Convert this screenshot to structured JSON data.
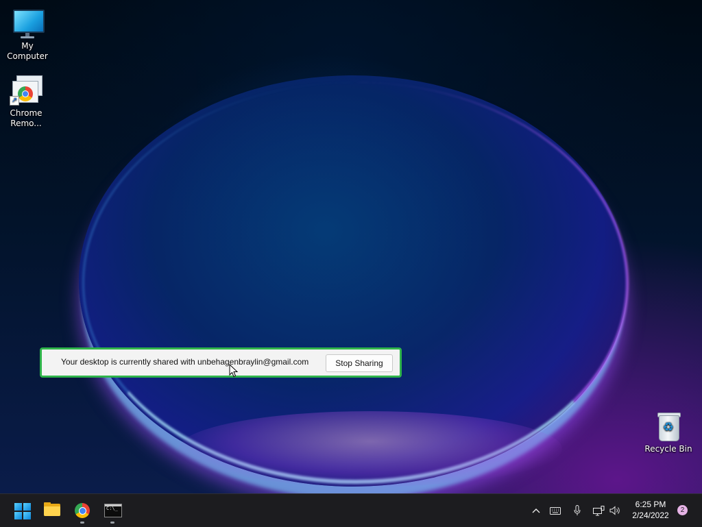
{
  "desktop": {
    "icons": [
      {
        "label": "My Computer",
        "icon": "monitor-icon"
      },
      {
        "label": "Chrome Remo...",
        "label_line1": "Chrome",
        "label_line2": "Remo...",
        "icon": "chrome-remote-desktop-icon"
      },
      {
        "label": "Recycle Bin",
        "icon": "recycle-bin-icon"
      }
    ]
  },
  "share_bar": {
    "message": "Your desktop is currently shared with unbehagenbraylin@gmail.com",
    "stop_label": "Stop Sharing",
    "border_color": "#2fb44a"
  },
  "taskbar": {
    "apps": [
      {
        "name": "start",
        "icon": "windows-logo-icon"
      },
      {
        "name": "file-explorer",
        "icon": "folder-icon"
      },
      {
        "name": "chrome",
        "icon": "chrome-icon",
        "running": true
      },
      {
        "name": "terminal",
        "icon": "terminal-icon",
        "running": true
      }
    ],
    "tray_icons": [
      "chevron-up-icon",
      "keyboard-icon",
      "microphone-icon",
      "network-icon",
      "volume-icon"
    ],
    "time": "6:25 PM",
    "date": "2/24/2022",
    "notification_count": "2"
  }
}
